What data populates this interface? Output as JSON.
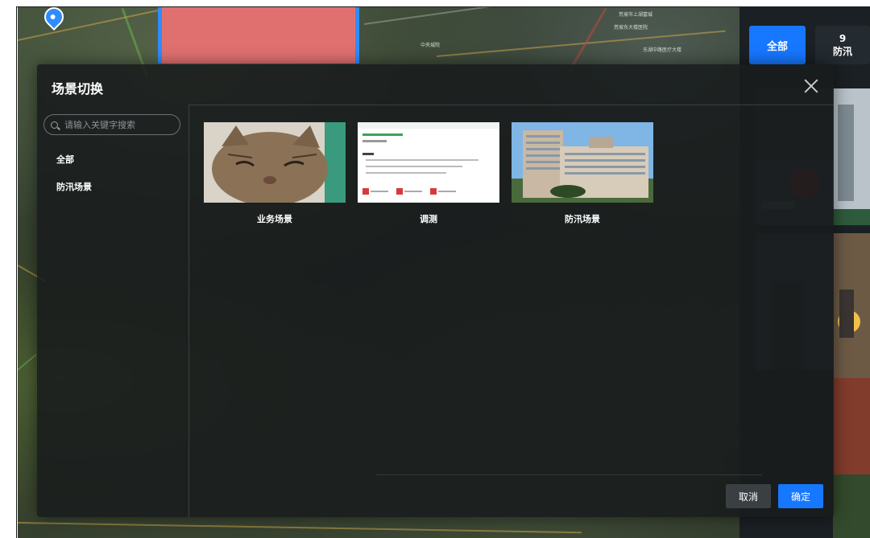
{
  "map": {
    "labels": [
      "荒坡市上湖富城",
      "荒坡东大楼医院",
      "东湖中路医疗大楼",
      "中央城院"
    ]
  },
  "top_tabs": {
    "all_label": "全部",
    "flood_count": "9",
    "flood_label": "防汛"
  },
  "dialog": {
    "title": "场景切换",
    "search_placeholder": "请输入关键字搜索",
    "categories": [
      "全部",
      "防汛场景"
    ],
    "cards": [
      {
        "label": "业务场景",
        "image": "cat-photo"
      },
      {
        "label": "调测",
        "image": "webpage-screenshot"
      },
      {
        "label": "防汛场景",
        "image": "hospital-building-photo"
      }
    ],
    "cancel_label": "取消",
    "confirm_label": "确定"
  },
  "colors": {
    "accent": "#1677ff",
    "dialog_bg": "#181b1d",
    "redblock": "#e07070"
  }
}
